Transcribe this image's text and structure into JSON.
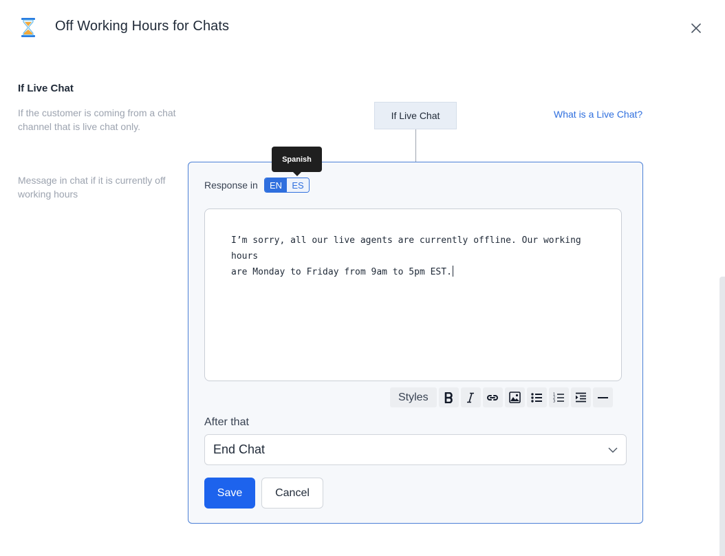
{
  "header": {
    "title": "Off Working Hours for Chats",
    "icon": "hourglass-icon"
  },
  "left": {
    "section_title": "If Live Chat",
    "section_desc": "If the customer is coming from a chat channel that is live chat only.",
    "message_desc": "Message in chat if it is currently off working hours"
  },
  "node": {
    "label": "If Live Chat",
    "help_link": "What is a Live Chat?"
  },
  "panel": {
    "response_label": "Response in",
    "languages": [
      {
        "code": "EN",
        "active": true
      },
      {
        "code": "ES",
        "active": false
      }
    ],
    "tooltip": "Spanish",
    "message": "I’m sorry, all our live agents are currently offline. Our working hours\nare Monday to Friday from 9am to 5pm EST.",
    "toolbar": {
      "styles_label": "Styles",
      "buttons": [
        "bold-icon",
        "italic-icon",
        "link-icon",
        "image-icon",
        "bulleted-list-icon",
        "numbered-list-icon",
        "indent-icon",
        "horizontal-rule-icon"
      ]
    },
    "after_label": "After that",
    "after_value": "End Chat",
    "save_label": "Save",
    "cancel_label": "Cancel"
  },
  "colors": {
    "accent": "#1d63ed",
    "panel_border": "#4a7fd6",
    "link": "#2f6fde",
    "muted_text": "#9ca3af"
  }
}
